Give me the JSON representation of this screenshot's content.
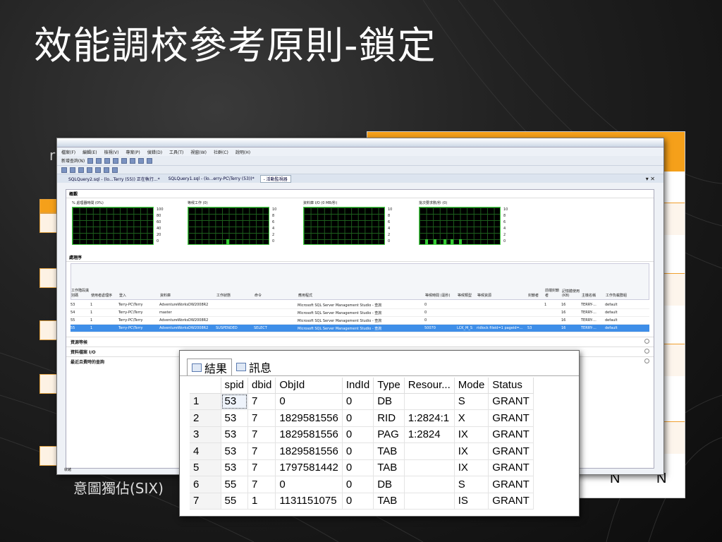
{
  "slide": {
    "title": "效能調校參考原則-鎖定"
  },
  "background": {
    "caption": "意圖獨佔(SIX)",
    "ghost_text": "r",
    "table_cells": [
      "N",
      "N"
    ]
  },
  "ssms": {
    "menu": [
      "檔案(F)",
      "編輯(E)",
      "檢視(V)",
      "專案(P)",
      "偵錯(D)",
      "工具(T)",
      "視窗(W)",
      "社群(C)",
      "說明(H)"
    ],
    "new_query": "新增查詢(N)",
    "doc_tabs": [
      "SQLQuery2.sql - (lo...Terry (55)) 正在執行...*",
      "SQLQuery1.sql - (lo...erry-PC\\Terry (53))*",
      "- 活動監視器"
    ],
    "sections": {
      "overview": "概觀",
      "processes": "處理序",
      "resource_waits": "資源等候",
      "data_file_io": "資料檔案 I/O",
      "expensive_queries": "最近且費時的查詢"
    },
    "graphs": [
      {
        "label": "% 處理器時間 (0%)",
        "ticks": [
          "100",
          "80",
          "60",
          "40",
          "20",
          "0"
        ]
      },
      {
        "label": "等候工作 (0)",
        "ticks": [
          "10",
          "8",
          "6",
          "4",
          "2",
          "0"
        ]
      },
      {
        "label": "資料庫 I/O (0 MB/秒)",
        "ticks": [
          "10",
          "8",
          "6",
          "4",
          "2",
          "0"
        ]
      },
      {
        "label": "批次要求數/秒 (0)",
        "ticks": [
          "10",
          "8",
          "6",
          "4",
          "2",
          "0"
        ]
      }
    ],
    "proc_columns": [
      "工作階段識別碼",
      "使用者處理序",
      "登入",
      "資料庫",
      "工作狀態",
      "命令",
      "應用程式",
      "等候時間 (毫秒)",
      "等候類型",
      "等候資源",
      "封鎖者",
      "前端封鎖者",
      "記憶體使用 (KB)",
      "主機名稱",
      "工作負載群組"
    ],
    "proc_rows": [
      {
        "id": "53",
        "user": "1",
        "login": "Terry-PC\\Terry",
        "db": "AdventureWorksDW2008R2",
        "status": "",
        "cmd": "",
        "app": "Microsoft SQL Server Management Studio - 查詢",
        "wait": "0",
        "wtype": "",
        "wres": "",
        "blk": "",
        "head": "1",
        "mem": "16",
        "host": "TERRY-...",
        "grp": "default"
      },
      {
        "id": "54",
        "user": "1",
        "login": "Terry-PC\\Terry",
        "db": "master",
        "status": "",
        "cmd": "",
        "app": "Microsoft SQL Server Management Studio - 查詢",
        "wait": "0",
        "wtype": "",
        "wres": "",
        "blk": "",
        "head": "",
        "mem": "16",
        "host": "TERRY-...",
        "grp": "default"
      },
      {
        "id": "55",
        "user": "1",
        "login": "Terry-PC\\Terry",
        "db": "AdventureWorksDW2008R2",
        "status": "",
        "cmd": "",
        "app": "Microsoft SQL Server Management Studio - 查詢",
        "wait": "0",
        "wtype": "",
        "wres": "",
        "blk": "",
        "head": "",
        "mem": "16",
        "host": "TERRY-...",
        "grp": "default"
      },
      {
        "id": "55",
        "user": "1",
        "login": "Terry-PC\\Terry",
        "db": "AdventureWorksDW2008R2",
        "status": "SUSPENDED",
        "cmd": "SELECT",
        "app": "Microsoft SQL Server Management Studio - 查詢",
        "wait": "50070",
        "wtype": "LCK_M_S",
        "wres": "ridlock fileid=1 pageid=...",
        "blk": "53",
        "head": "",
        "mem": "16",
        "host": "TERRY-...",
        "grp": "default"
      }
    ],
    "status_text": "就緒"
  },
  "results": {
    "tabs": {
      "results": "結果",
      "messages": "訊息"
    },
    "columns": [
      "spid",
      "dbid",
      "ObjId",
      "IndId",
      "Type",
      "Resour...",
      "Mode",
      "Status"
    ],
    "rows": [
      [
        "1",
        "53",
        "7",
        "0",
        "0",
        "DB",
        "",
        "S",
        "GRANT"
      ],
      [
        "2",
        "53",
        "7",
        "1829581556",
        "0",
        "RID",
        "1:2824:1",
        "X",
        "GRANT"
      ],
      [
        "3",
        "53",
        "7",
        "1829581556",
        "0",
        "PAG",
        "1:2824",
        "IX",
        "GRANT"
      ],
      [
        "4",
        "53",
        "7",
        "1829581556",
        "0",
        "TAB",
        "",
        "IX",
        "GRANT"
      ],
      [
        "5",
        "53",
        "7",
        "1797581442",
        "0",
        "TAB",
        "",
        "IX",
        "GRANT"
      ],
      [
        "6",
        "55",
        "7",
        "0",
        "0",
        "DB",
        "",
        "S",
        "GRANT"
      ],
      [
        "7",
        "55",
        "1",
        "1131151075",
        "0",
        "TAB",
        "",
        "IS",
        "GRANT"
      ]
    ]
  },
  "colors": {
    "accent": "#f5a01a",
    "selection": "#3e8ee8"
  }
}
